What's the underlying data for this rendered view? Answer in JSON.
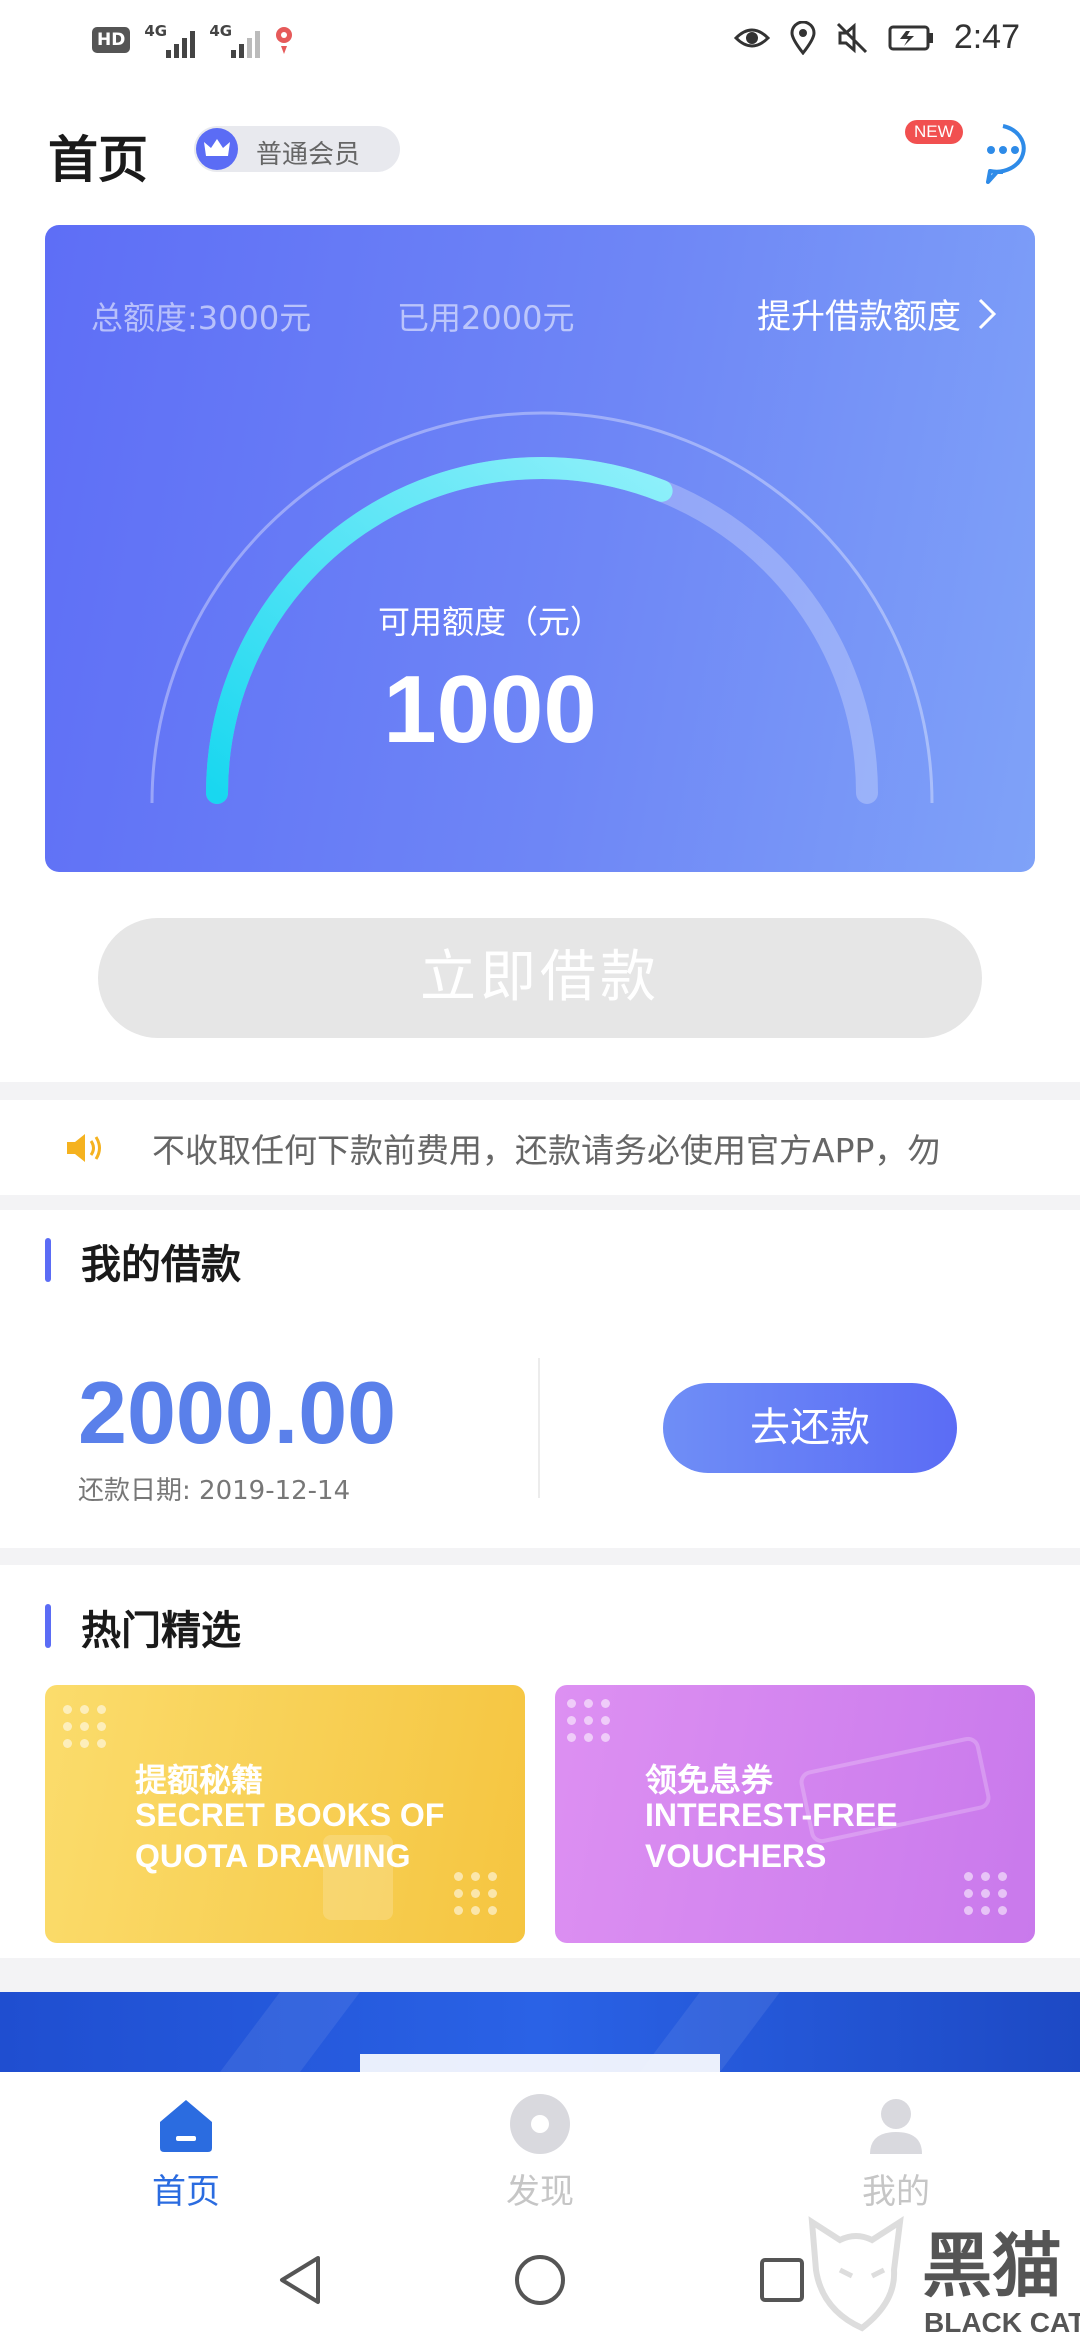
{
  "status_bar": {
    "hd_label": "HD",
    "signal_labels": [
      "4G",
      "4G"
    ],
    "time": "2:47",
    "icons": [
      "eye-icon",
      "location-icon",
      "mute-icon",
      "battery-charging-icon"
    ]
  },
  "header": {
    "title": "首页",
    "member_level": "普通会员",
    "new_badge": "NEW",
    "message_icon": "chat-bubble-icon"
  },
  "credit_card": {
    "total_quota": "总额度:3000元",
    "used_quota": "已用2000元",
    "raise_link": "提升借款额度",
    "available_label": "可用额度（元）",
    "available_amount": "1000",
    "gauge_fraction": 0.62
  },
  "borrow_button": "立即借款",
  "notice": {
    "text": "不收取任何下款前费用，还款请务必使用官方APP，勿"
  },
  "my_loan": {
    "title": "我的借款",
    "amount": "2000.00",
    "due_date": "还款日期: 2019-12-14",
    "repay_button": "去还款"
  },
  "featured": {
    "title": "热门精选",
    "cards": [
      {
        "title_cn": "提额秘籍",
        "title_en": "SECRET BOOKS OF QUOTA DRAWING",
        "color": "#f5c540"
      },
      {
        "title_cn": "领免息券",
        "title_en": "INTEREST-FREE VOUCHERS",
        "color": "#c979ec"
      }
    ]
  },
  "tab_bar": {
    "tabs": [
      {
        "label": "首页",
        "active": true
      },
      {
        "label": "发现",
        "active": false
      },
      {
        "label": "我的",
        "active": false
      }
    ]
  },
  "watermark": {
    "cn": "黑猫",
    "en": "BLACK CAT"
  },
  "colors": {
    "accent": "#5b6cf5",
    "amount_blue": "#5a80ea",
    "gauge_cyan": "#22d3f0"
  }
}
